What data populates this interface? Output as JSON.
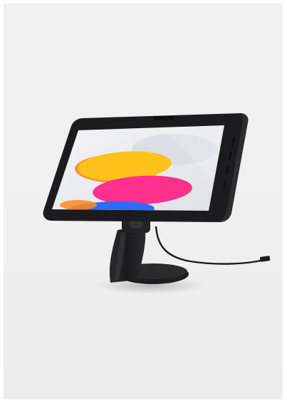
{
  "image": {
    "subject": "tablet-kiosk-stand",
    "colors": {
      "background": "#efefef",
      "enclosure": "#1c1c1e",
      "stand": "#1f1f21",
      "screen_base": "#e9eaee",
      "wave_yellow": "#ffc21a",
      "wave_pink": "#ff2f8e",
      "wave_blue": "#2b6cff",
      "wave_orange": "#ff8a1c"
    }
  }
}
